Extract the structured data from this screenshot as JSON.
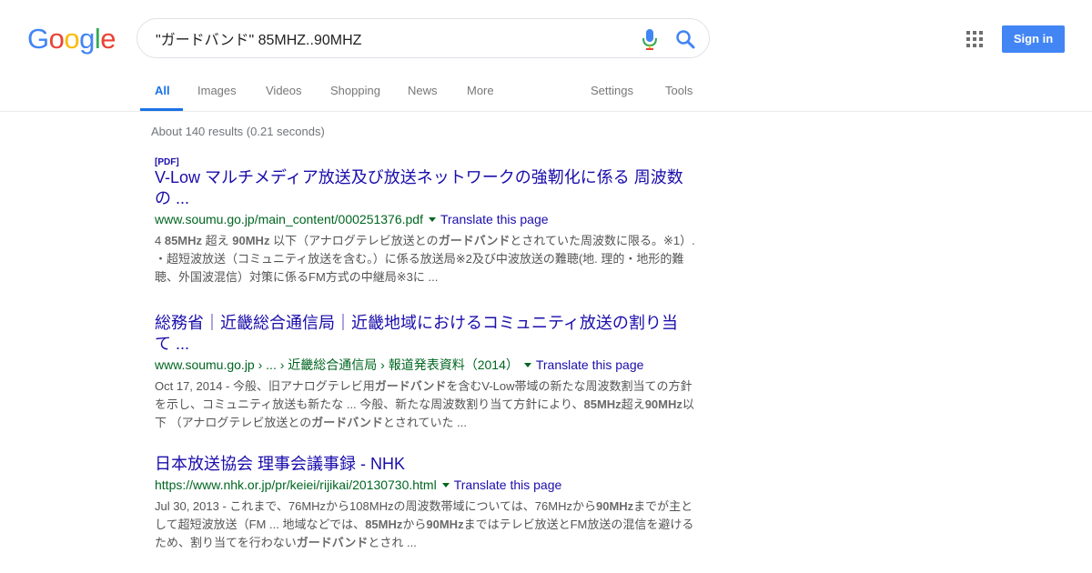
{
  "logo": {
    "letters": [
      "G",
      "o",
      "o",
      "g",
      "l",
      "e"
    ],
    "colors": [
      "#4285F4",
      "#EA4335",
      "#FBBC05",
      "#4285F4",
      "#34A853",
      "#EA4335"
    ]
  },
  "search": {
    "query": "\"ガードバンド\" 85MHZ..90MHZ"
  },
  "header": {
    "signin_label": "Sign in"
  },
  "tabs": {
    "all": "All",
    "images": "Images",
    "videos": "Videos",
    "shopping": "Shopping",
    "news": "News",
    "more": "More",
    "settings": "Settings",
    "tools": "Tools"
  },
  "stats": "About 140 results (0.21 seconds)",
  "results": [
    {
      "badge": "[PDF]",
      "title_line1": "V-Low マルチメディア放送及び放送ネットワークの強靭化に係る 周波数",
      "title_line2": "の ...",
      "url": "www.soumu.go.jp/main_content/000251376.pdf",
      "translate": "Translate this page",
      "snippet_parts": [
        {
          "t": "4 ",
          "b": false
        },
        {
          "t": "85MHz",
          "b": true
        },
        {
          "t": " 超え ",
          "b": false
        },
        {
          "t": "90MHz",
          "b": true
        },
        {
          "t": " 以下（アナログテレビ放送との",
          "b": false
        },
        {
          "t": "ガードバンド",
          "b": true
        },
        {
          "t": "とされていた周波数に限る。※1）. ・超短波放送（コミュニティ放送を含む。）に係る放送局※2及び中波放送の難聴(地. 理的・地形的難聴、外国波混信）対策に係るFM方式の中継局※3に ...",
          "b": false
        }
      ]
    },
    {
      "title_line1": "総務省｜近畿総合通信局｜近畿地域におけるコミュニティ放送の割り当",
      "title_line2": "て ...",
      "url": "www.soumu.go.jp › ... › 近畿総合通信局 › 報道発表資料（2014）",
      "translate": "Translate this page",
      "snippet_parts": [
        {
          "t": "Oct 17, 2014 - 今般、旧アナログテレビ用",
          "b": false
        },
        {
          "t": "ガードバンド",
          "b": true
        },
        {
          "t": "を含むV-Low帯域の新たな周波数割当ての方針を示し、コミュニティ放送も新たな ... 今般、新たな周波数割り当て方針により、",
          "b": false
        },
        {
          "t": "85MHz",
          "b": true
        },
        {
          "t": "超え",
          "b": false
        },
        {
          "t": "90MHz",
          "b": true
        },
        {
          "t": "以下 （アナログテレビ放送との",
          "b": false
        },
        {
          "t": "ガードバンド",
          "b": true
        },
        {
          "t": "とされていた ...",
          "b": false
        }
      ]
    },
    {
      "title_line1": "日本放送協会 理事会議事録 - NHK",
      "url": "https://www.nhk.or.jp/pr/keiei/rijikai/20130730.html",
      "translate": "Translate this page",
      "snippet_parts": [
        {
          "t": "Jul 30, 2013 - これまで、76MHzから108MHzの周波数帯域については、76MHzから",
          "b": false
        },
        {
          "t": "90MHz",
          "b": true
        },
        {
          "t": "までが主として超短波放送（FM ... 地域などでは、",
          "b": false
        },
        {
          "t": "85MHz",
          "b": true
        },
        {
          "t": "から",
          "b": false
        },
        {
          "t": "90MHz",
          "b": true
        },
        {
          "t": "まではテレビ放送とFM放送の混信を避けるため、割り当てを行わない",
          "b": false
        },
        {
          "t": "ガードバンド",
          "b": true
        },
        {
          "t": "とされ ...",
          "b": false
        }
      ]
    }
  ]
}
